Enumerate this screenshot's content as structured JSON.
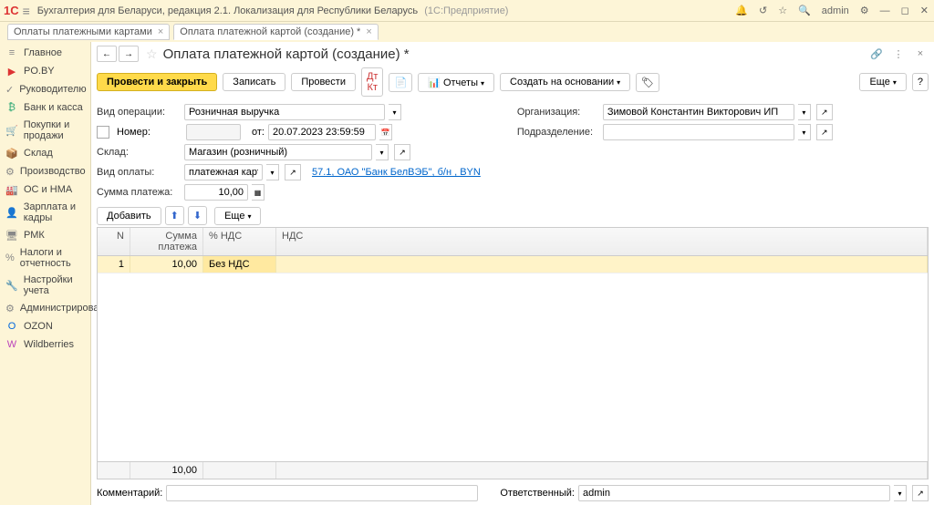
{
  "titlebar": {
    "app": "Бухгалтерия для Беларуси, редакция 2.1. Локализация для Республики Беларусь",
    "platform": "(1С:Предприятие)",
    "user": "admin"
  },
  "tabs": [
    {
      "label": "Оплаты платежными картами"
    },
    {
      "label": "Оплата платежной картой (создание) *"
    }
  ],
  "sidebar": [
    {
      "icon": "≡",
      "label": "Главное",
      "color": "#888"
    },
    {
      "icon": "▶",
      "label": "PO.BY",
      "color": "#d33"
    },
    {
      "icon": "✓",
      "label": "Руководителю",
      "color": "#888"
    },
    {
      "icon": "₿",
      "label": "Банк и касса",
      "color": "#3a7"
    },
    {
      "icon": "🛒",
      "label": "Покупки и продажи",
      "color": "#3a7"
    },
    {
      "icon": "📦",
      "label": "Склад",
      "color": "#c80"
    },
    {
      "icon": "⚙",
      "label": "Производство",
      "color": "#888"
    },
    {
      "icon": "🏭",
      "label": "ОС и НМА",
      "color": "#d55"
    },
    {
      "icon": "👤",
      "label": "Зарплата и кадры",
      "color": "#58c"
    },
    {
      "icon": "🖥",
      "label": "РМК",
      "color": "#888"
    },
    {
      "icon": "%",
      "label": "Налоги и отчетность",
      "color": "#888"
    },
    {
      "icon": "🔧",
      "label": "Настройки учета",
      "color": "#888"
    },
    {
      "icon": "⚙",
      "label": "Администрирование",
      "color": "#888"
    },
    {
      "icon": "O",
      "label": "OZON",
      "color": "#06d"
    },
    {
      "icon": "W",
      "label": "Wildberries",
      "color": "#b4b"
    }
  ],
  "page": {
    "title": "Оплата платежной картой (создание) *"
  },
  "toolbar": {
    "post_close": "Провести и закрыть",
    "write": "Записать",
    "post": "Провести",
    "reports": "Отчеты",
    "create_based": "Создать на основании",
    "more": "Еще"
  },
  "form": {
    "op_type_label": "Вид операции:",
    "op_type": "Розничная выручка",
    "number_label": "Номер:",
    "from_label": "от:",
    "date": "20.07.2023 23:59:59",
    "warehouse_label": "Склад:",
    "warehouse": "Магазин (розничный)",
    "pay_type_label": "Вид оплаты:",
    "pay_type": "платежная карта",
    "pay_link": "57.1, ОАО \"Банк БелВЭБ\", б/н , BYN",
    "amount_label": "Сумма платежа:",
    "amount": "10,00",
    "org_label": "Организация:",
    "org": "Зимовой Константин Викторович ИП",
    "dept_label": "Подразделение:"
  },
  "subtoolbar": {
    "add": "Добавить",
    "more": "Еще"
  },
  "table": {
    "headers": {
      "n": "N",
      "sum": "Сумма платежа",
      "vat": "% НДС",
      "vatv": "НДС"
    },
    "rows": [
      {
        "n": "1",
        "sum": "10,00",
        "vat": "Без НДС",
        "vatv": ""
      }
    ],
    "footer": {
      "sum": "10,00"
    }
  },
  "footer": {
    "comment_label": "Комментарий:",
    "resp_label": "Ответственный:",
    "resp": "admin"
  }
}
